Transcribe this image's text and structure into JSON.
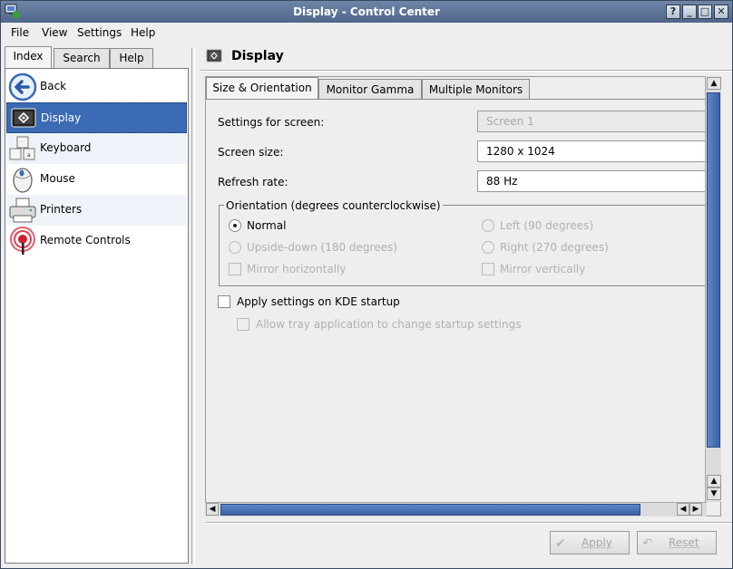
{
  "window": {
    "title": "Display - Control Center"
  },
  "titlebar_buttons": {
    "help": "?",
    "minimize": "_",
    "maximize": "□",
    "close": "✕"
  },
  "menubar": [
    {
      "label": "File"
    },
    {
      "label": "View"
    },
    {
      "label": "Settings"
    },
    {
      "label": "Help"
    }
  ],
  "left_tabs": [
    {
      "label": "Index",
      "active": true
    },
    {
      "label": "Search",
      "active": false
    },
    {
      "label": "Help",
      "active": false
    }
  ],
  "modules": [
    {
      "label": "Back",
      "icon": "back-arrow-icon",
      "selected": false
    },
    {
      "label": "Display",
      "icon": "display-icon",
      "selected": true
    },
    {
      "label": "Keyboard",
      "icon": "keyboard-icon",
      "selected": false
    },
    {
      "label": "Mouse",
      "icon": "mouse-icon",
      "selected": false
    },
    {
      "label": "Printers",
      "icon": "printer-icon",
      "selected": false
    },
    {
      "label": "Remote Controls",
      "icon": "remote-control-icon",
      "selected": false
    }
  ],
  "panel": {
    "title": "Display",
    "tabs": [
      {
        "label": "Size & Orientation",
        "active": true
      },
      {
        "label": "Monitor Gamma",
        "active": false
      },
      {
        "label": "Multiple Monitors",
        "active": false
      }
    ],
    "fields": {
      "screen_label": "Settings for screen:",
      "screen_value": "Screen 1",
      "size_label": "Screen size:",
      "size_value": "1280 x 1024",
      "refresh_label": "Refresh rate:",
      "refresh_value": "88 Hz"
    },
    "orientation": {
      "title": "Orientation (degrees counterclockwise)",
      "normal": "Normal",
      "left": "Left (90 degrees)",
      "upside_down": "Upside-down (180 degrees)",
      "right": "Right (270 degrees)",
      "mirror_h": "Mirror horizontally",
      "mirror_v": "Mirror vertically",
      "selected": "Normal"
    },
    "apply_on_startup": "Apply settings on KDE startup",
    "allow_tray": "Allow tray application to change startup settings"
  },
  "buttons": {
    "apply": "Apply",
    "reset": "Reset"
  },
  "colors": {
    "selection": "#3a6bb4",
    "titlebar": "#5c7398",
    "scroll_thumb": "#4a74b8"
  }
}
